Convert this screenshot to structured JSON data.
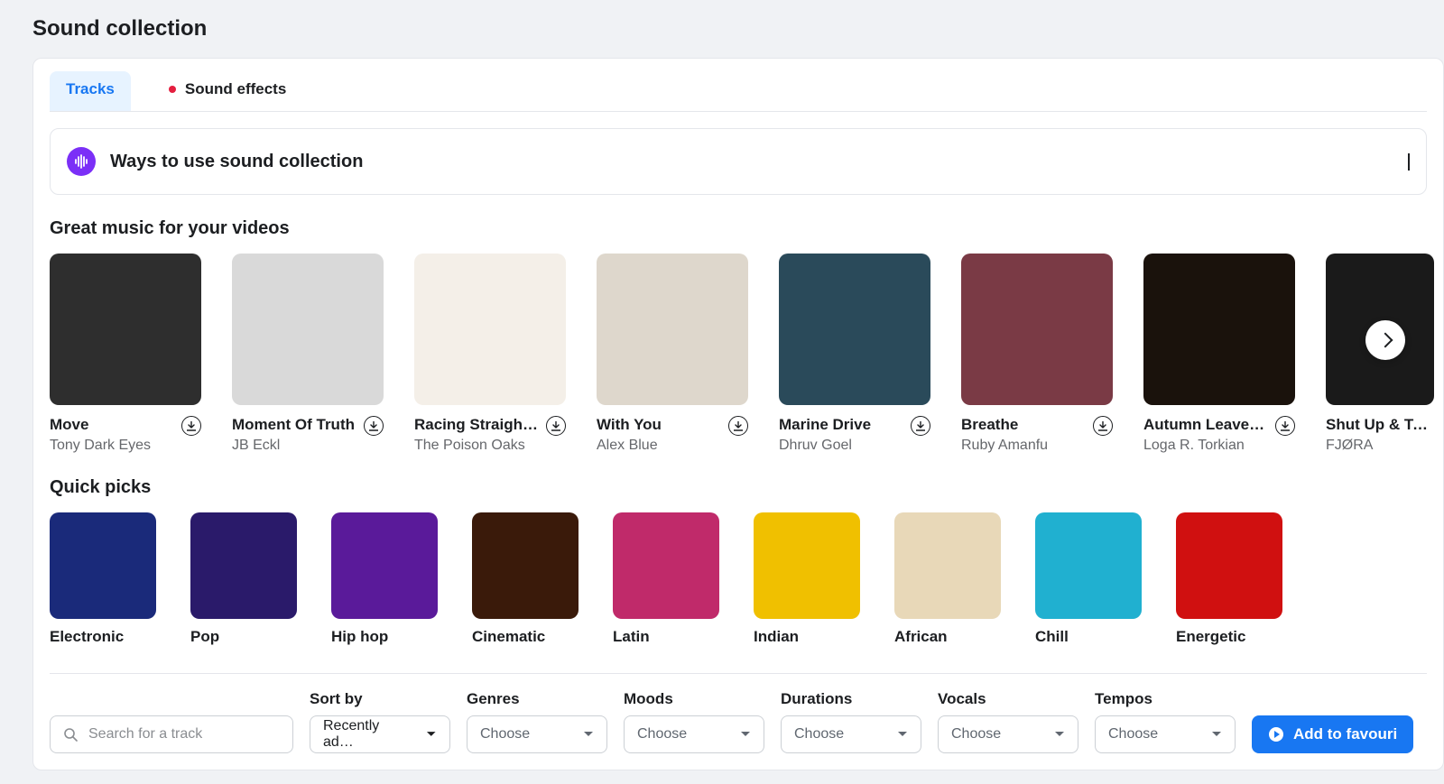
{
  "title": "Sound collection",
  "tabs": {
    "tracks": "Tracks",
    "sound_effects": "Sound effects"
  },
  "banner": {
    "title": "Ways to use sound collection"
  },
  "sections": {
    "great_music": "Great music for your videos",
    "quick_picks": "Quick picks"
  },
  "tracks": [
    {
      "title": "Move",
      "artist": "Tony Dark Eyes"
    },
    {
      "title": "Moment Of Truth",
      "artist": "JB Eckl"
    },
    {
      "title": "Racing Straight…",
      "artist": "The Poison Oaks"
    },
    {
      "title": "With You",
      "artist": "Alex Blue"
    },
    {
      "title": "Marine Drive",
      "artist": "Dhruv Goel"
    },
    {
      "title": "Breathe",
      "artist": "Ruby Amanfu"
    },
    {
      "title": "Autumn Leaves…",
      "artist": "Loga R. Torkian"
    },
    {
      "title": "Shut Up & Take",
      "artist": "FJØRA"
    }
  ],
  "quick_picks": [
    {
      "label": "Electronic"
    },
    {
      "label": "Pop"
    },
    {
      "label": "Hip hop"
    },
    {
      "label": "Cinematic"
    },
    {
      "label": "Latin"
    },
    {
      "label": "Indian"
    },
    {
      "label": "African"
    },
    {
      "label": "Chill"
    },
    {
      "label": "Energetic"
    }
  ],
  "search": {
    "placeholder": "Search for a track"
  },
  "filters": {
    "sort_label": "Sort by",
    "sort_value": "Recently ad…",
    "genres_label": "Genres",
    "moods_label": "Moods",
    "durations_label": "Durations",
    "vocals_label": "Vocals",
    "tempos_label": "Tempos",
    "choose": "Choose"
  },
  "fav_button": "Add to favouri",
  "art_colors": [
    "#2e2e2e",
    "#d9d9d9",
    "#f4efe8",
    "#ded7cc",
    "#2a4a5a",
    "#7a3a45",
    "#1a120c",
    "#1a1a1a"
  ],
  "quick_colors": [
    "#1a2a7a",
    "#2a1a6a",
    "#5a1a9a",
    "#3a1a0a",
    "#c02a6a",
    "#f0c000",
    "#e8d8b8",
    "#20b0d0",
    "#d01010"
  ]
}
